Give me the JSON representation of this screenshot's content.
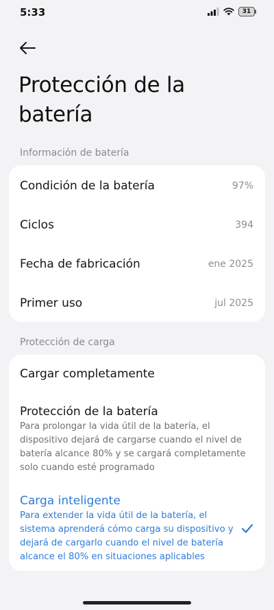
{
  "status_bar": {
    "time": "5:33",
    "battery_level": "31"
  },
  "header": {
    "title": "Protección de la batería"
  },
  "battery_info": {
    "section_title": "Información de batería",
    "rows": [
      {
        "label": "Condición de la batería",
        "value": "97%"
      },
      {
        "label": "Ciclos",
        "value": "394"
      },
      {
        "label": "Fecha de fabricación",
        "value": "ene 2025"
      },
      {
        "label": "Primer uso",
        "value": "jul 2025"
      }
    ]
  },
  "charge_protection": {
    "section_title": "Protección de carga",
    "options": [
      {
        "title": "Cargar completamente",
        "description": "",
        "selected": false
      },
      {
        "title": "Protección de la batería",
        "description": "Para prolongar la vida útil de la batería, el dispositivo dejará de cargarse cuando el nivel de batería alcance 80% y se cargará completamente solo cuando esté programado",
        "selected": false
      },
      {
        "title": "Carga inteligente",
        "description": "Para extender la vida útil de la batería, el sistema aprenderá cómo carga su dispositivo y dejará de cargarlo cuando el nivel de batería alcance el 80% en situaciones aplicables",
        "selected": true
      }
    ]
  },
  "colors": {
    "accent": "#2f7bd9",
    "background": "#f3f3f5",
    "card": "#ffffff",
    "secondary_text": "#8d8d92"
  }
}
